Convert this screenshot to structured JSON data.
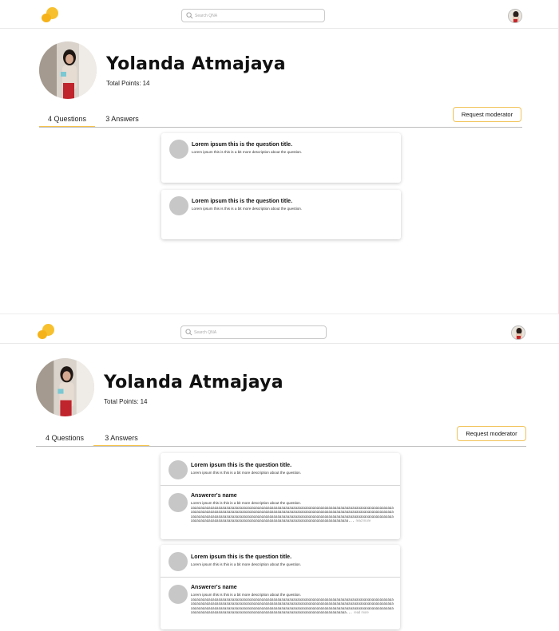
{
  "screens": [
    {
      "search": {
        "placeholder": "Search QNA"
      },
      "profile": {
        "name": "Yolanda Atmajaya",
        "points_label": "Total Points:",
        "points": "14"
      },
      "tabs": [
        {
          "label": "4 Questions",
          "active": true
        },
        {
          "label": "3 Answers",
          "active": false
        }
      ],
      "moderator_button": "Request moderator",
      "questions": [
        {
          "title": "Lorem ipsum this is the question title.",
          "description": "Lorem ipsum this is this is a bit more description about the question."
        },
        {
          "title": "Lorem ipsum this is the question title.",
          "description": "Lorem ipsum this is this is a bit more description about the question."
        }
      ]
    },
    {
      "search": {
        "placeholder": "Search QNA"
      },
      "profile": {
        "name": "Yolanda Atmajaya",
        "points_label": "Total Points:",
        "points": "14"
      },
      "tabs": [
        {
          "label": "4 Questions",
          "active": false
        },
        {
          "label": "3 Answers",
          "active": true
        }
      ],
      "moderator_button": "Request moderator",
      "answers": [
        {
          "question_title": "Lorem ipsum this is the question title.",
          "question_description": "Lorem ipsum this is this is a bit more description about the question.",
          "answerer_name": "Answerer's name",
          "answer_description": "Lorem ipsum this is this is a bit more description about the question.",
          "answer_body": "aaaaaaaaaaaaaaaaaaaaaaaaaaaaaaaaaaaaaaaaaaaaaaaaaaaaaaaaaaaaaaaaaaaaaaaaaaaaaaaaaaaaaaaaaaaaaaaaaaaaaaaaaaaaaaaaaaaaaaaaaaaaaaaaaaaaaaaaaaaaaaaaaaaaaaaaaaaaaaaaaaaaaaaaaaaaaaaaaaaaaaaaaaaaaaaaaaaaaaaaaaaaaaaaaaaaaaaaaaaaaaaaaaaaaaaaaaaaaaaaaaaaaaaaaaaaaaaaaaaaaaaaaaaaaaaaaaaaaaaaaaaaaaaaaaaaaaaaaaaaaaaaaaaaaaaaaaaaaaaaaaaaaaaaaaaaaaaaaaaaaaaaaaaaaaaaaaaaaaaaaaaaaaaaaaaaaaaaaaaaaaaaaaaaa...",
          "read_more": "read more"
        },
        {
          "question_title": "Lorem ipsum this is the question title.",
          "question_description": "Lorem ipsum this is this is a bit more description about the question.",
          "answerer_name": "Answerer's name",
          "answer_description": "Lorem ipsum this is this is a bit more description about the question.",
          "answer_body": "aaaaaaaaaaaaaaaaaaaaaaaaaaaaaaaaaaaaaaaaaaaaaaaaaaaaaaaaaaaaaaaaaaaaaaaaaaaaaaaaaaaaaaaaaaaaaaaaaaaaaaaaaaaaaaaaaaaaaaaaaaaaaaaaaaaaaaaaaaaaaaaaaaaaaaaaaaaaaaaaaaaaaaaaaaaaaaaaaaaaaaaaaaaaaaaaaaaaaaaaaaaaaaaaaaaaaaaaaaaaaaaaaaaaaaaaaaaaaaaaaaaaaaaaaaaaaaaaaaaaaaaaaaaaaaaaaaaaaaaaaaaaaaaaaaaaaaaaaaaaaaaaaaaaaaaaaaaaaaaaaaaaaaaaaaaaaaaaaaaaaaaaaaaaaaaaaaaaaaaaaaaaaaaaaaaaaaaaaaaaaaaaaaaa...",
          "read_more": "read more"
        }
      ]
    }
  ],
  "colors": {
    "accent": "#f6c34a",
    "logo": "#f7c02e",
    "avatar_placeholder": "#c7c7c7"
  },
  "icons": {
    "logo": "chat-bubbles-logo",
    "search": "search-icon"
  }
}
